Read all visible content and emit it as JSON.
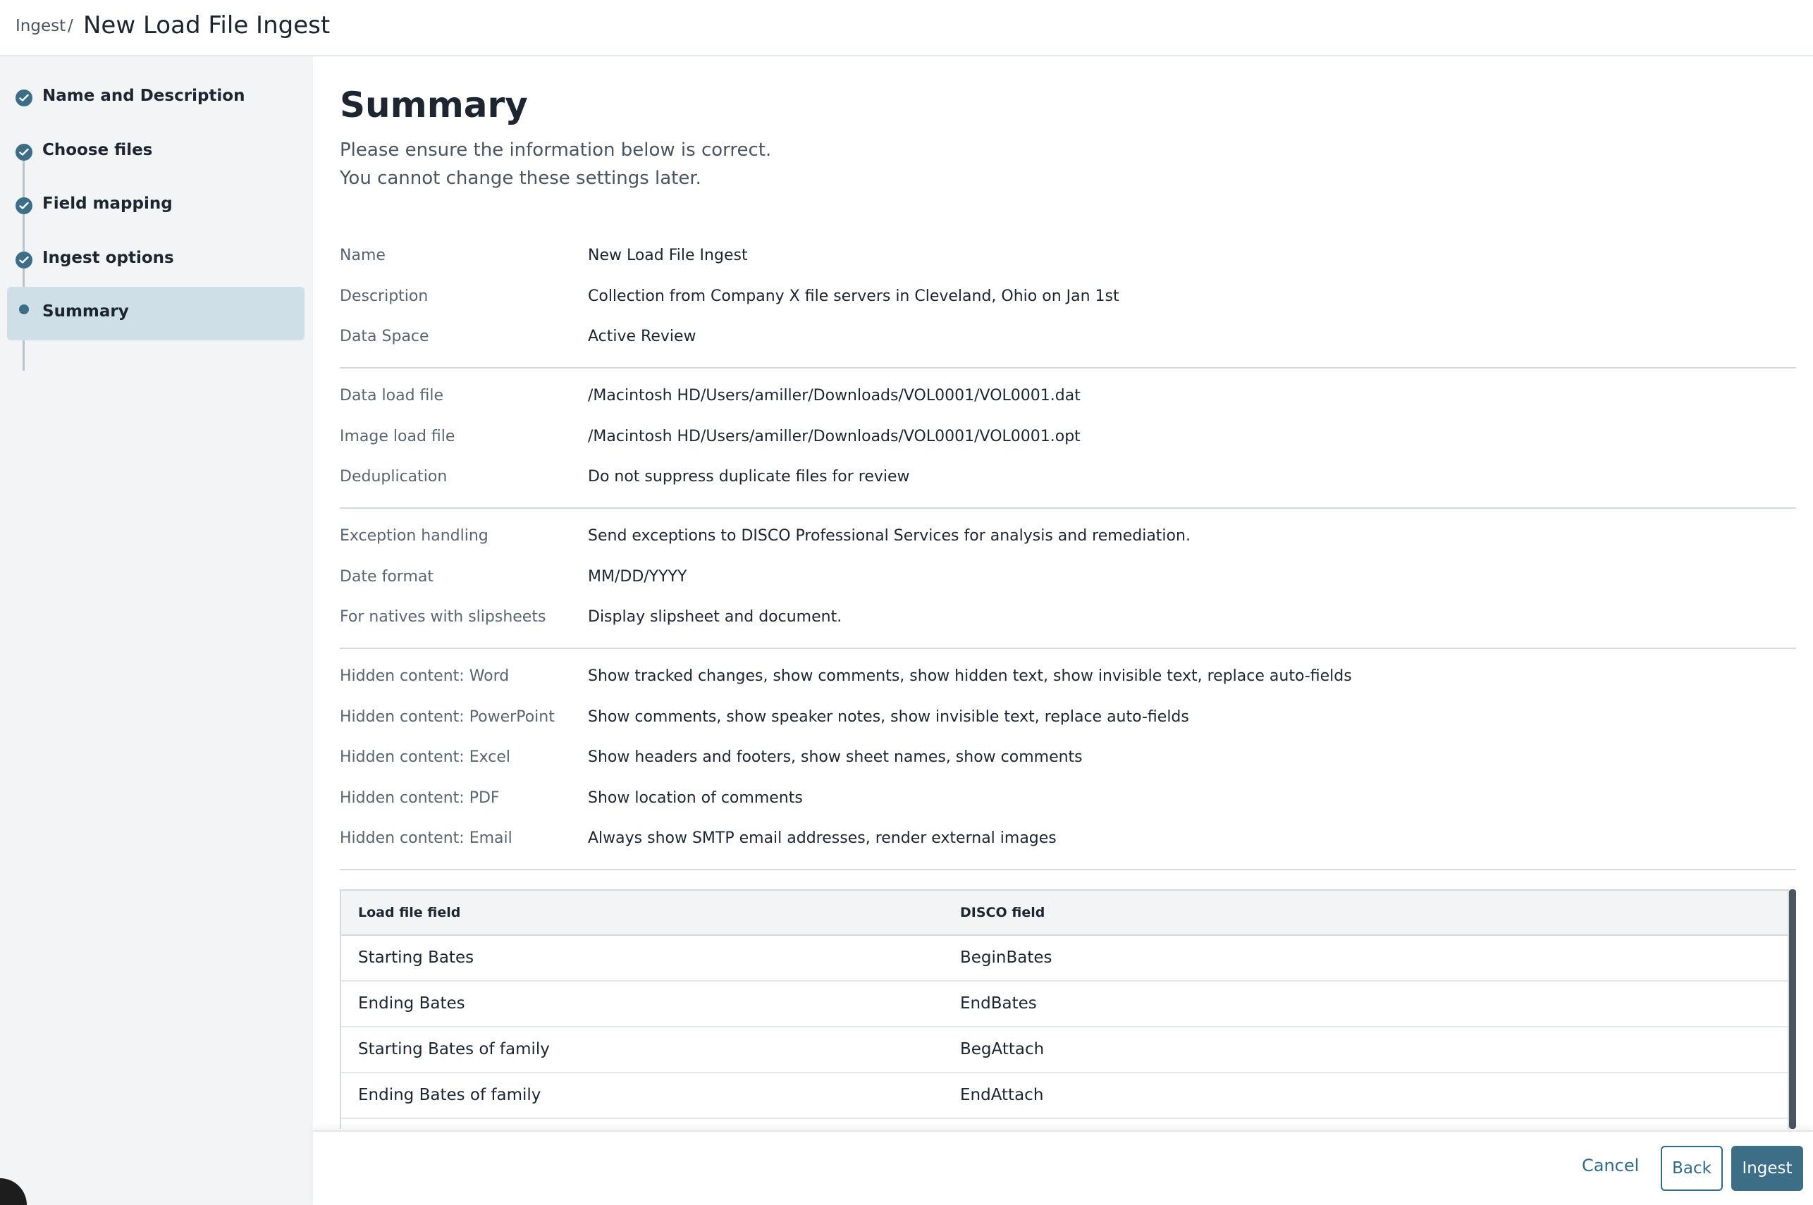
{
  "header": {
    "breadcrumb": "Ingest",
    "separator": "/",
    "title": "New Load File Ingest"
  },
  "steps": [
    {
      "label": "Name and Description",
      "state": "complete"
    },
    {
      "label": "Choose files",
      "state": "complete"
    },
    {
      "label": "Field mapping",
      "state": "complete"
    },
    {
      "label": "Ingest options",
      "state": "complete"
    },
    {
      "label": "Summary",
      "state": "current"
    }
  ],
  "summary": {
    "title": "Summary",
    "subtitle_line1": "Please ensure the information below is correct.",
    "subtitle_line2": "You cannot change these settings later.",
    "rows": [
      {
        "label": "Name",
        "value": "New Load File Ingest"
      },
      {
        "label": "Description",
        "value": "Collection from Company X file servers in Cleveland, Ohio on Jan 1st"
      },
      {
        "label": "Data Space",
        "value": "Active Review"
      },
      {
        "label": "Data load file",
        "value": "/Macintosh HD/Users/amiller/Downloads/VOL0001/VOL0001.dat"
      },
      {
        "label": "Image load file",
        "value": "/Macintosh HD/Users/amiller/Downloads/VOL0001/VOL0001.opt"
      },
      {
        "label": "Deduplication",
        "value": "Do not suppress duplicate files for review"
      },
      {
        "label": "Exception handling",
        "value": "Send exceptions to DISCO Professional Services for analysis and remediation."
      },
      {
        "label": "Date format",
        "value": "MM/DD/YYYY"
      },
      {
        "label": "For natives with slipsheets",
        "value": "Display slipsheet and document."
      },
      {
        "label": "Hidden content: Word",
        "value": "Show tracked changes, show comments, show hidden text, show invisible text, replace auto-fields"
      },
      {
        "label": "Hidden content: PowerPoint",
        "value": "Show comments, show speaker notes, show invisible text, replace auto-fields"
      },
      {
        "label": "Hidden content: Excel",
        "value": "Show headers and footers, show sheet names, show comments"
      },
      {
        "label": "Hidden content: PDF",
        "value": "Show location of comments"
      },
      {
        "label": "Hidden content: Email",
        "value": "Always show SMTP email addresses, render external images"
      }
    ]
  },
  "mapping_table": {
    "headers": [
      "Load file field",
      "DISCO field"
    ],
    "rows": [
      [
        "Starting Bates",
        "BeginBates"
      ],
      [
        "Ending Bates",
        "EndBates"
      ],
      [
        "Starting Bates of family",
        "BegAttach"
      ],
      [
        "Ending Bates of family",
        "EndAttach"
      ]
    ]
  },
  "footer": {
    "cancel_label": "Cancel",
    "back_label": "Back",
    "ingest_label": "Ingest"
  },
  "colors": {
    "accent": "#3c6e87",
    "active_step_bg": "#cfdfe8",
    "sidebar_bg": "#f3f4f6"
  }
}
